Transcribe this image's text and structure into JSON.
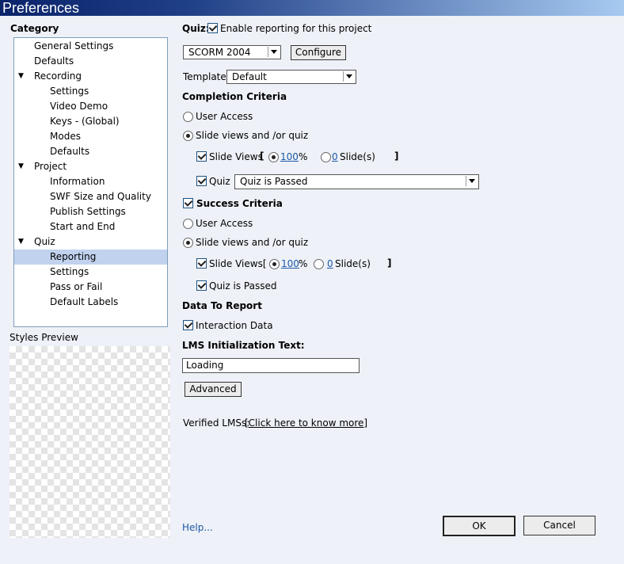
{
  "window": {
    "title": "Preferences"
  },
  "category": {
    "heading": "Category",
    "items": [
      {
        "label": "General Settings"
      },
      {
        "label": "Defaults"
      },
      {
        "label": "Recording",
        "expanded": true
      },
      {
        "label": "Settings"
      },
      {
        "label": "Video Demo"
      },
      {
        "label": "Keys - (Global)"
      },
      {
        "label": "Modes"
      },
      {
        "label": "Defaults"
      },
      {
        "label": "Project",
        "expanded": true
      },
      {
        "label": "Information"
      },
      {
        "label": "SWF Size and Quality"
      },
      {
        "label": "Publish Settings"
      },
      {
        "label": "Start and End"
      },
      {
        "label": "Quiz",
        "expanded": true
      },
      {
        "label": "Reporting",
        "selected": true
      },
      {
        "label": "Settings"
      },
      {
        "label": "Pass or Fail"
      },
      {
        "label": "Default Labels"
      }
    ]
  },
  "styles_preview": {
    "label": "Styles Preview"
  },
  "quiz": {
    "label": "Quiz:",
    "enable_reporting": {
      "label": "Enable reporting for this project",
      "checked": true
    },
    "standard": {
      "value": "SCORM 2004"
    },
    "configure_label": "Configure",
    "template": {
      "label": "Template:",
      "value": "Default"
    }
  },
  "completion": {
    "heading": "Completion Criteria",
    "user_access": {
      "label": "User Access",
      "selected": false
    },
    "slide_views_or_quiz": {
      "label": "Slide views and /or quiz",
      "selected": true
    },
    "slide_views": {
      "label": "Slide Views",
      "bracket_open": "[",
      "percent_value": "100",
      "percent_sign": "%",
      "slides_value": "0",
      "slides_label": "Slide(s)",
      "bracket_close": "]",
      "checked": true
    },
    "quiz": {
      "label": "Quiz",
      "value": "Quiz is Passed",
      "checked": true
    }
  },
  "success": {
    "heading": "Success Criteria",
    "checked": true,
    "user_access": {
      "label": "User Access",
      "selected": false
    },
    "slide_views_or_quiz": {
      "label": "Slide views and /or quiz",
      "selected": true
    },
    "slide_views": {
      "label": "Slide Views[",
      "percent_value": "100",
      "percent_sign": "%",
      "slides_value": "0",
      "slides_label": "Slide(s)",
      "bracket_close": "]",
      "checked": true
    },
    "quiz_passed": {
      "label": "Quiz is Passed",
      "checked": true
    }
  },
  "data_to_report": {
    "heading": "Data To Report",
    "interaction_data": {
      "label": "Interaction Data",
      "checked": true
    }
  },
  "lms": {
    "heading": "LMS Initialization Text:",
    "value": "Loading",
    "advanced_label": "Advanced",
    "verified_label": "Verified LMSs:",
    "verified_link": "[Click here to know more]"
  },
  "footer": {
    "help": "Help...",
    "ok": "OK",
    "cancel": "Cancel"
  },
  "colors": {
    "link": "#1c58a8",
    "selection": "#c1d2ee",
    "title_bar": "#0a246a"
  }
}
